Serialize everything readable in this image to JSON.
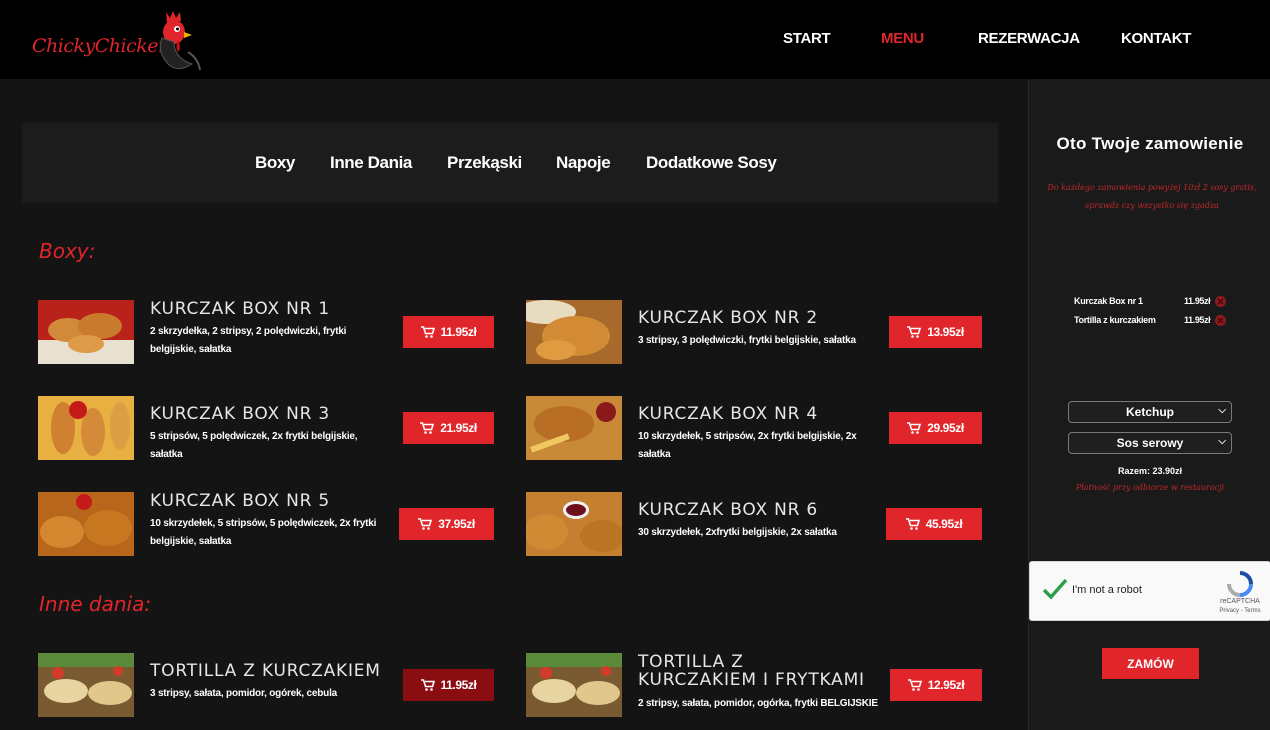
{
  "brand": {
    "logo_text": "ChickyChicken",
    "accent_color": "#e0252b"
  },
  "nav": {
    "items": [
      {
        "label": "START"
      },
      {
        "label": "MENU",
        "active": true
      },
      {
        "label": "REZERWACJA"
      },
      {
        "label": "KONTAKT"
      }
    ]
  },
  "categories": [
    "Boxy",
    "Inne Dania",
    "Przekąski",
    "Napoje",
    "Dodatkowe Sosy"
  ],
  "sections": [
    {
      "title": "Boxy:",
      "items": [
        {
          "name": "KURCZAK BOX NR 1",
          "desc": "2 skrzydełka, 2 stripsy, 2 polędwiczki, frytki belgijskie, sałatka",
          "price": "11.95zł"
        },
        {
          "name": "KURCZAK BOX NR 2",
          "desc": "3 stripsy, 3 polędwiczki, frytki belgijskie, sałatka",
          "price": "13.95zł"
        },
        {
          "name": "KURCZAK BOX NR 3",
          "desc": "5 stripsów, 5 polędwiczek, 2x frytki belgijskie, sałatka",
          "price": "21.95zł"
        },
        {
          "name": "KURCZAK BOX NR 4",
          "desc": "10 skrzydełek, 5 stripsów, 2x frytki belgijskie, 2x sałatka",
          "price": "29.95zł"
        },
        {
          "name": "KURCZAK BOX NR 5",
          "desc": "10 skrzydełek, 5 stripsów, 5 polędwiczek, 2x frytki belgijskie, sałatka",
          "price": "37.95zł"
        },
        {
          "name": "KURCZAK BOX NR 6",
          "desc": "30 skrzydełek, 2xfrytki belgijskie, 2x sałatka",
          "price": "45.95zł"
        }
      ]
    },
    {
      "title": "Inne dania:",
      "items": [
        {
          "name": "TORTILLA Z KURCZAKIEM",
          "desc": "3 stripsy, sałata, pomidor, ogórek, cebula",
          "price": "11.95zł"
        },
        {
          "name": "TORTILLA Z KURCZAKIEM I FRYTKAMI",
          "desc": "2 stripsy, sałata, pomidor, ogórka, frytki BELGIJSKIE",
          "price": "12.95zł"
        }
      ]
    }
  ],
  "order": {
    "title": "Oto Twoje zamowienie",
    "note": "Do każdego zamowienia powyżej 10zł 2 sosy gratis, sprawdz czy wszystko się zgadza",
    "lines": [
      {
        "name": "Kurczak Box nr 1",
        "price": "11.95zł"
      },
      {
        "name": "Tortilla z kurczakiem",
        "price": "11.95zł"
      }
    ],
    "sauce_1": "Ketchup",
    "sauce_2": "Sos serowy",
    "total": "Razem: 23.90zł",
    "payment_note": "Płatność przy odbiorze w restauracji",
    "captcha_label": "I'm not a robot",
    "captcha_brand": "reCAPTCHA",
    "captcha_links": "Privacy - Terms",
    "submit": "ZAMÓW"
  }
}
